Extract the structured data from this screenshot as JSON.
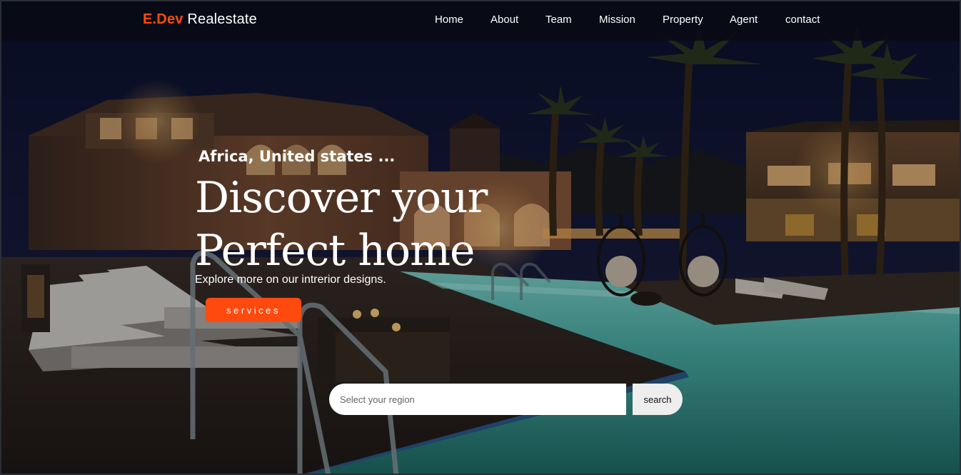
{
  "navbar": {
    "brand_accent": "E.Dev",
    "brand_rest": "Realestate",
    "links": [
      "Home",
      "About",
      "Team",
      "Mission",
      "Property",
      "Agent",
      "contact"
    ]
  },
  "hero": {
    "location": "Africa, United states ...",
    "headline_line1": "Discover your",
    "headline_line2": "Perfect home",
    "subtitle": "Explore more on our intrerior designs.",
    "services_label": "services",
    "background_image": "night-resort-pool-with-palms"
  },
  "search": {
    "placeholder": "Select your region",
    "button_label": "search"
  },
  "colors": {
    "accent": "#ff4a0f",
    "navbar_bg": "#0a0c16",
    "text": "#ffffff"
  }
}
